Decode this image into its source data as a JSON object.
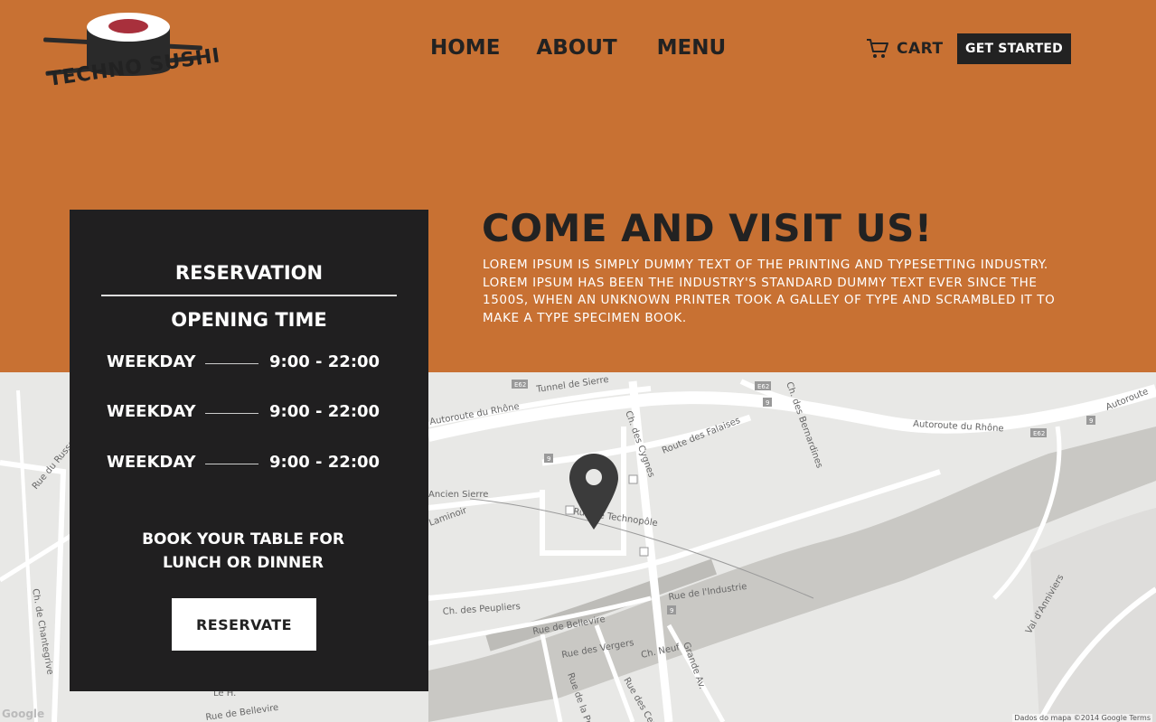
{
  "brand": {
    "name": "TECHNO SUSHI",
    "colors": {
      "hero_bg": "#c87133",
      "dark": "#201f20",
      "nori": "#2a2a2a",
      "tuna": "#a8303c"
    }
  },
  "nav": {
    "items": [
      {
        "label": "HOME"
      },
      {
        "label": "ABOUT"
      },
      {
        "label": "MENU"
      }
    ]
  },
  "header": {
    "cart_label": "CART",
    "cart_icon": "cart-icon",
    "cta_label": "GET STARTED"
  },
  "visit": {
    "title": "COME AND VISIT US!",
    "body": "Lorem Ipsum is simply dummy text of the printing and typesetting industry. Lorem Ipsum has been the industry's standard dummy text ever since the 1500s, when an unknown printer took a galley of type and scrambled it to make a type specimen book."
  },
  "reservation": {
    "title": "RESERVATION",
    "opening_title": "OPENING TIME",
    "hours": [
      {
        "day": "WEEKDAY",
        "time": "9:00 - 22:00"
      },
      {
        "day": "WEEKDAY",
        "time": "9:00 - 22:00"
      },
      {
        "day": "WEEKDAY",
        "time": "9:00 - 22:00"
      }
    ],
    "book_line1": "BOOK YOUR TABLE FOR",
    "book_line2": "LUNCH OR DINNER",
    "button_label": "RESERVATE"
  },
  "map": {
    "pin_icon": "map-pin-icon",
    "labels": {
      "tunnel": "Tunnel de Sierre",
      "autoroute_left": "Autoroute du Rhône",
      "autoroute_right": "Autoroute du Rhône",
      "autoroute_far": "Autoroute",
      "falaises": "Route des Falaises",
      "cygnes": "Ch. des Cygnes",
      "bernadines": "Ch. des Bernardines",
      "ancien": "Ancien Sierre",
      "techno": "Rue de Technopôle",
      "laminoir": "Laminoir",
      "russe": "Rue du Russe",
      "peupliers": "Ch. des Peupliers",
      "industrie": "Rue de l'Industrie",
      "bellevire": "Rue de Bellevire",
      "vergers": "Rue des Vergers",
      "neuf": "Ch. Neuf",
      "grande": "Grande Av.",
      "annivers": "Val d'Anniviers",
      "chantegrive": "Ch. de Chantegrive",
      "bellevue_bottom": "Rue de Bellevire",
      "le": "Le H.",
      "cerisiers": "Rue des Cerisiers",
      "pres": "Rue de la Pr.",
      "e62a": "E62",
      "e62b": "E62",
      "e62c": "E62",
      "n9a": "9",
      "n9b": "9",
      "n9c": "9",
      "n9d": "9"
    },
    "attribution": "Dados do mapa ©2014 Google   Terms",
    "google_logo": "Google"
  }
}
